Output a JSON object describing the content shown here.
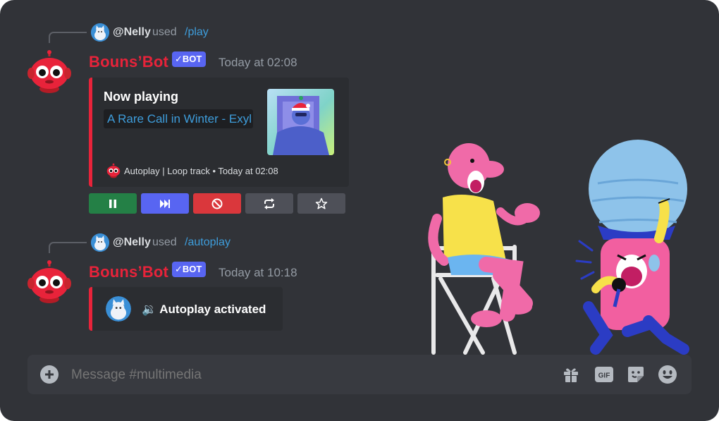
{
  "colors": {
    "background": "#313338",
    "embed_bg": "#2b2d31",
    "accent_red": "#e8233a",
    "blurple": "#5865f2",
    "link_blue": "#3e9ddb",
    "green_button": "#248046",
    "red_button": "#da373c",
    "grey_button": "#4e5058"
  },
  "messages": [
    {
      "reply": {
        "user": "@Nelly",
        "used": "used",
        "command": "/play"
      },
      "author": "Bouns’Bot",
      "badge": "BOT",
      "timestamp": "Today at 02:08",
      "embed": {
        "title": "Now playing",
        "track": "A Rare Call in Winter - Exyl",
        "footer": "Autoplay | Loop track • Today at 02:08"
      },
      "buttons": [
        {
          "name": "pause",
          "icon": "pause-icon",
          "color": "#248046"
        },
        {
          "name": "skip",
          "icon": "skip-icon",
          "color": "#5865f2"
        },
        {
          "name": "stop",
          "icon": "stop-icon",
          "color": "#da373c"
        },
        {
          "name": "loop",
          "icon": "repeat-icon",
          "color": "#4e5058"
        },
        {
          "name": "favorite",
          "icon": "star-icon",
          "color": "#4e5058"
        }
      ]
    },
    {
      "reply": {
        "user": "@Nelly",
        "used": "used",
        "command": "/autoplay"
      },
      "author": "Bouns’Bot",
      "badge": "BOT",
      "timestamp": "Today at 10:18",
      "embed": {
        "text": "🔉 Autoplay activated"
      }
    }
  ],
  "composer": {
    "placeholder": "Message #multimedia",
    "icons": [
      "add-icon",
      "gift-icon",
      "gif-icon",
      "sticker-icon",
      "emoji-icon"
    ]
  }
}
